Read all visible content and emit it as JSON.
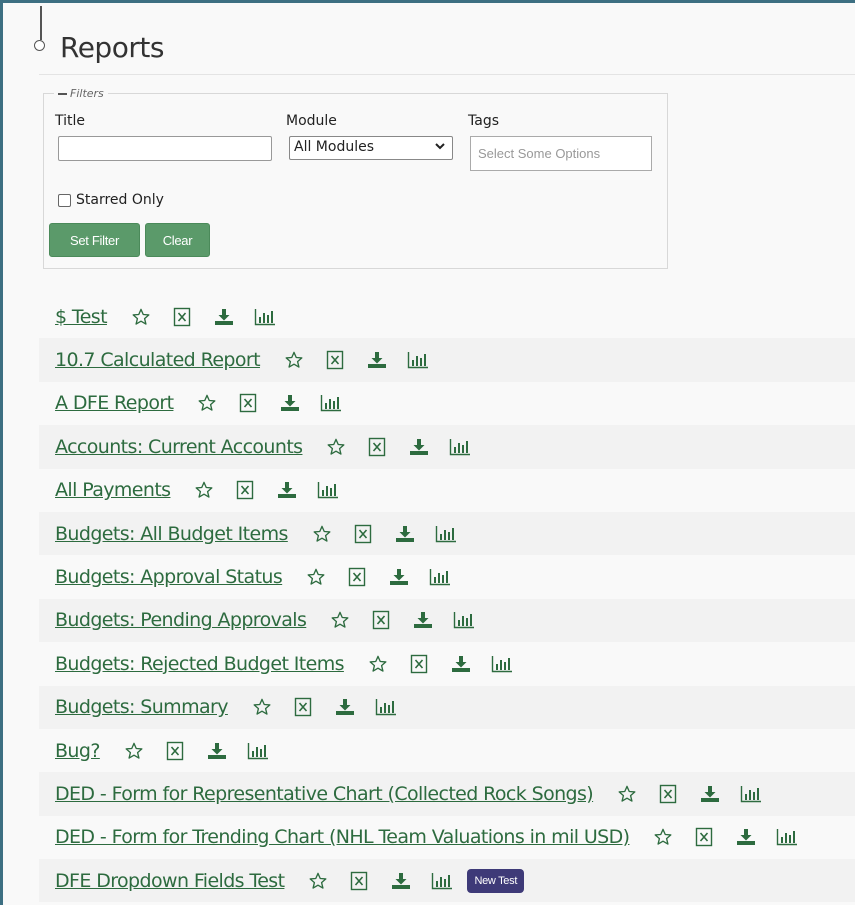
{
  "page": {
    "title": "Reports"
  },
  "filters": {
    "legend": "Filters",
    "title_label": "Title",
    "title_value": "",
    "module_label": "Module",
    "module_selected": "All Modules",
    "tags_label": "Tags",
    "tags_placeholder": "Select Some Options",
    "starred_label": "Starred Only",
    "set_filter_label": "Set Filter",
    "clear_label": "Clear"
  },
  "icons": {
    "star": "star-outline-icon",
    "excel": "excel-icon",
    "download": "download-icon",
    "chart": "bar-chart-icon"
  },
  "colors": {
    "link": "#2d6b3f",
    "button": "#5b9a6a",
    "frame": "#3d6f82",
    "badge": "#3e3a78"
  },
  "reports": [
    {
      "title": "$ Test",
      "tag": ""
    },
    {
      "title": "10.7 Calculated Report",
      "tag": ""
    },
    {
      "title": "A DFE Report",
      "tag": ""
    },
    {
      "title": "Accounts: Current Accounts",
      "tag": ""
    },
    {
      "title": "All Payments",
      "tag": ""
    },
    {
      "title": "Budgets: All Budget Items",
      "tag": ""
    },
    {
      "title": "Budgets: Approval Status",
      "tag": ""
    },
    {
      "title": "Budgets: Pending Approvals",
      "tag": ""
    },
    {
      "title": "Budgets: Rejected Budget Items",
      "tag": ""
    },
    {
      "title": "Budgets: Summary",
      "tag": ""
    },
    {
      "title": "Bug?",
      "tag": ""
    },
    {
      "title": "DED - Form for Representative Chart (Collected Rock Songs)",
      "tag": ""
    },
    {
      "title": "DED - Form for Trending Chart (NHL Team Valuations in mil USD)",
      "tag": ""
    },
    {
      "title": "DFE Dropdown Fields Test",
      "tag": "New Test"
    }
  ]
}
